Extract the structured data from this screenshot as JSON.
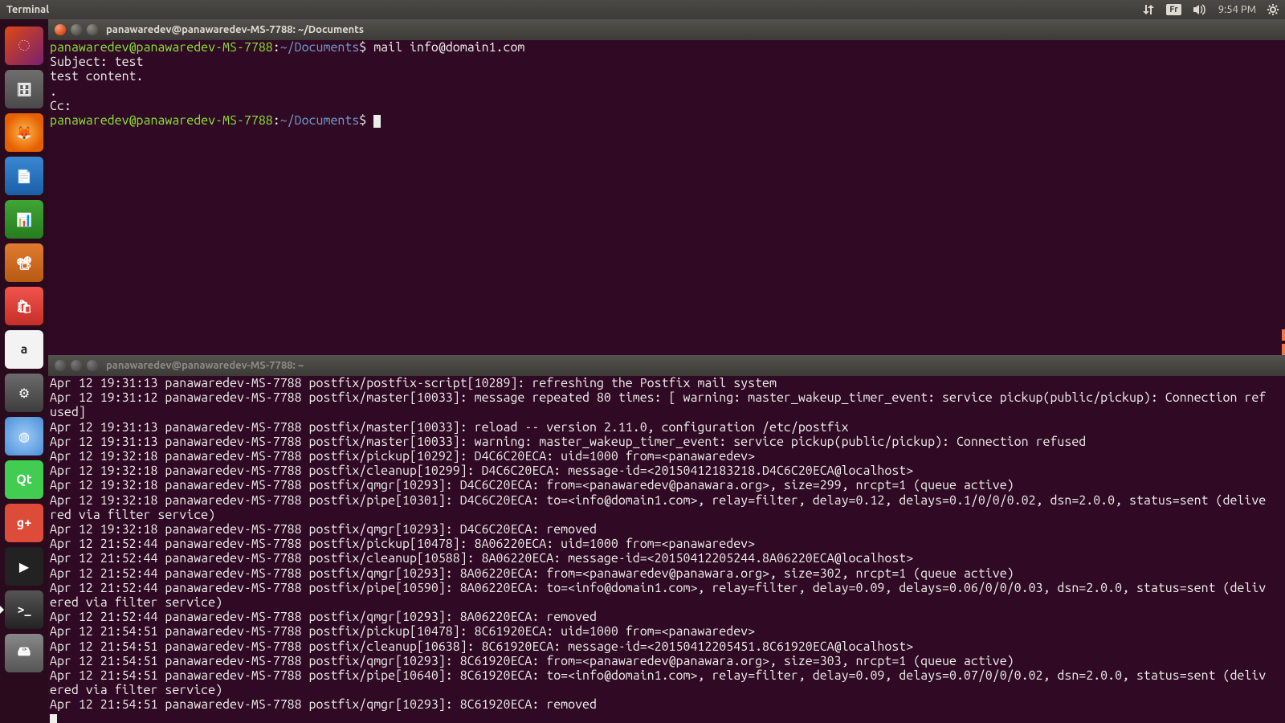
{
  "top_bar": {
    "app_label": "Terminal",
    "lang": "Fr",
    "clock": "9:54 PM"
  },
  "launcher": {
    "items": [
      {
        "name": "dash",
        "bg": "linear-gradient(135deg,#dd4814,#77216f)",
        "glyph": "◌"
      },
      {
        "name": "files",
        "bg": "linear-gradient(#6e6e6e,#4a4a4a)",
        "glyph": "🗄"
      },
      {
        "name": "firefox",
        "bg": "radial-gradient(circle,#ffb84d,#e66000 70%)",
        "glyph": "🦊"
      },
      {
        "name": "writer",
        "bg": "linear-gradient(#3a87d2,#1b5fa6)",
        "glyph": "📄"
      },
      {
        "name": "calc",
        "bg": "linear-gradient(#3fa535,#267d1e)",
        "glyph": "📊"
      },
      {
        "name": "impress",
        "bg": "linear-gradient(#e07b2e,#b85a14)",
        "glyph": "📽"
      },
      {
        "name": "software-center",
        "bg": "linear-gradient(#f0544c,#c42f28)",
        "glyph": "🛍"
      },
      {
        "name": "amazon",
        "bg": "#f3f3f3",
        "glyph": "a"
      },
      {
        "name": "settings",
        "bg": "linear-gradient(#6b6b6b,#3d3d3d)",
        "glyph": "⚙"
      },
      {
        "name": "chromium",
        "bg": "radial-gradient(circle,#9ecbf5,#4a8fd9)",
        "glyph": "◍"
      },
      {
        "name": "qt",
        "bg": "#41cd52",
        "glyph": "Qt"
      },
      {
        "name": "google-plus",
        "bg": "#dd4b39",
        "glyph": "g+"
      },
      {
        "name": "youtube",
        "bg": "#222",
        "glyph": "▶"
      },
      {
        "name": "terminal",
        "bg": "linear-gradient(#555,#222)",
        "glyph": ">_",
        "active": true
      },
      {
        "name": "devices",
        "bg": "linear-gradient(#888,#555)",
        "glyph": "🖴"
      }
    ]
  },
  "term1": {
    "title": "panawaredev@panawaredev-MS-7788: ~/Documents",
    "prompt_user_host": "panawaredev@panawaredev-MS-7788",
    "prompt_path": "~/Documents",
    "cmd1": "mail info@domain1.com",
    "line_subject": "Subject: test",
    "line_body": "test content.",
    "line_dot": ".",
    "line_cc": "Cc: "
  },
  "term2": {
    "title": "panawaredev@panawaredev-MS-7788: ~",
    "log_lines": [
      "Apr 12 19:31:13 panawaredev-MS-7788 postfix/postfix-script[10289]: refreshing the Postfix mail system",
      "Apr 12 19:31:12 panawaredev-MS-7788 postfix/master[10033]: message repeated 80 times: [ warning: master_wakeup_timer_event: service pickup(public/pickup): Connection ref",
      "used]",
      "Apr 12 19:31:13 panawaredev-MS-7788 postfix/master[10033]: reload -- version 2.11.0, configuration /etc/postfix",
      "Apr 12 19:31:13 panawaredev-MS-7788 postfix/master[10033]: warning: master_wakeup_timer_event: service pickup(public/pickup): Connection refused",
      "Apr 12 19:32:18 panawaredev-MS-7788 postfix/pickup[10292]: D4C6C20ECA: uid=1000 from=<panawaredev>",
      "Apr 12 19:32:18 panawaredev-MS-7788 postfix/cleanup[10299]: D4C6C20ECA: message-id=<20150412183218.D4C6C20ECA@localhost>",
      "Apr 12 19:32:18 panawaredev-MS-7788 postfix/qmgr[10293]: D4C6C20ECA: from=<panawaredev@panawara.org>, size=299, nrcpt=1 (queue active)",
      "Apr 12 19:32:18 panawaredev-MS-7788 postfix/pipe[10301]: D4C6C20ECA: to=<info@domain1.com>, relay=filter, delay=0.12, delays=0.1/0/0/0.02, dsn=2.0.0, status=sent (delive",
      "red via filter service)",
      "Apr 12 19:32:18 panawaredev-MS-7788 postfix/qmgr[10293]: D4C6C20ECA: removed",
      "Apr 12 21:52:44 panawaredev-MS-7788 postfix/pickup[10478]: 8A06220ECA: uid=1000 from=<panawaredev>",
      "Apr 12 21:52:44 panawaredev-MS-7788 postfix/cleanup[10588]: 8A06220ECA: message-id=<20150412205244.8A06220ECA@localhost>",
      "Apr 12 21:52:44 panawaredev-MS-7788 postfix/qmgr[10293]: 8A06220ECA: from=<panawaredev@panawara.org>, size=302, nrcpt=1 (queue active)",
      "Apr 12 21:52:44 panawaredev-MS-7788 postfix/pipe[10590]: 8A06220ECA: to=<info@domain1.com>, relay=filter, delay=0.09, delays=0.06/0/0/0.03, dsn=2.0.0, status=sent (deliv",
      "ered via filter service)",
      "Apr 12 21:52:44 panawaredev-MS-7788 postfix/qmgr[10293]: 8A06220ECA: removed",
      "Apr 12 21:54:51 panawaredev-MS-7788 postfix/pickup[10478]: 8C61920ECA: uid=1000 from=<panawaredev>",
      "Apr 12 21:54:51 panawaredev-MS-7788 postfix/cleanup[10638]: 8C61920ECA: message-id=<20150412205451.8C61920ECA@localhost>",
      "Apr 12 21:54:51 panawaredev-MS-7788 postfix/qmgr[10293]: 8C61920ECA: from=<panawaredev@panawara.org>, size=303, nrcpt=1 (queue active)",
      "Apr 12 21:54:51 panawaredev-MS-7788 postfix/pipe[10640]: 8C61920ECA: to=<info@domain1.com>, relay=filter, delay=0.09, delays=0.07/0/0/0.02, dsn=2.0.0, status=sent (deliv",
      "ered via filter service)",
      "Apr 12 21:54:51 panawaredev-MS-7788 postfix/qmgr[10293]: 8C61920ECA: removed"
    ]
  }
}
